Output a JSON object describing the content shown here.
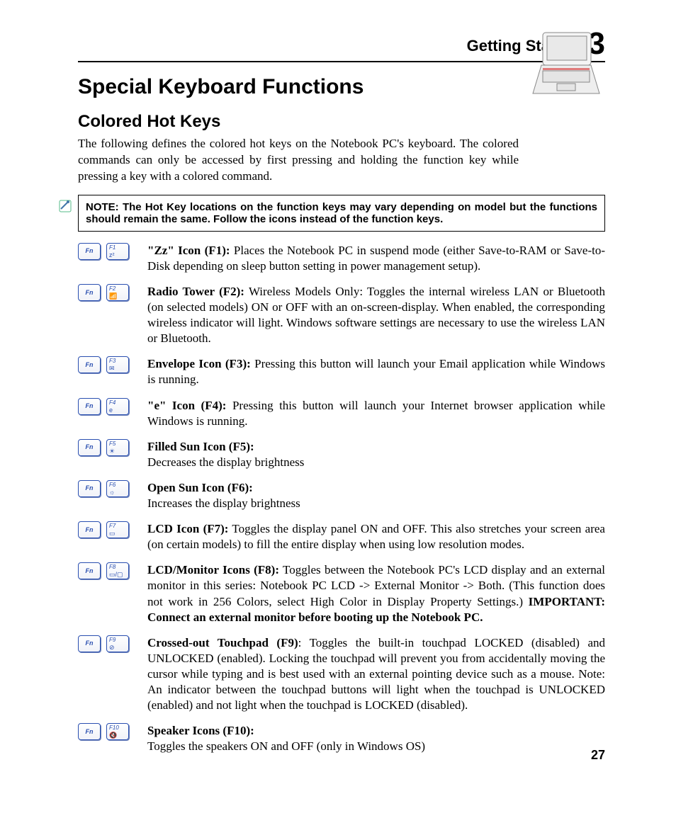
{
  "header": {
    "section_title": "Getting Started",
    "chapter_number": "3"
  },
  "titles": {
    "main": "Special Keyboard Functions",
    "sub": "Colored Hot Keys"
  },
  "intro": "The following defines the colored hot keys on the Notebook PC's keyboard. The colored commands can only be accessed by first pressing and holding the function key while pressing a key with a colored command.",
  "note": "NOTE: The Hot Key locations on the function keys may vary depending on model but the functions should remain the same. Follow the icons instead of the function keys.",
  "fn_label": "Fn",
  "hotkeys": [
    {
      "flabel": "F1",
      "glyph": "z²",
      "title": "\"Zz\" Icon (F1):",
      "desc": " Places the Notebook PC in suspend mode (either Save-to-RAM or Save-to-Disk depending on sleep button setting in power management setup)."
    },
    {
      "flabel": "F2",
      "glyph": "📶",
      "title": "Radio Tower (F2):",
      "desc": " Wireless Models Only: Toggles the internal wireless LAN or Bluetooth (on selected models) ON or OFF with an on-screen-display. When enabled, the corresponding wireless indicator will light. Windows software settings are necessary to use the wireless LAN or Bluetooth."
    },
    {
      "flabel": "F3",
      "glyph": "✉",
      "title": "Envelope Icon (F3):",
      "desc": " Pressing this button will launch your Email application while Windows is running."
    },
    {
      "flabel": "F4",
      "glyph": "e",
      "title": "\"e\" Icon (F4):",
      "desc": " Pressing this button will launch your Internet browser application while Windows is running."
    },
    {
      "flabel": "F5",
      "glyph": "☀",
      "title": "Filled Sun Icon (F5):",
      "desc": "Decreases the display brightness",
      "break": true
    },
    {
      "flabel": "F6",
      "glyph": "☼",
      "title": "Open Sun Icon (F6):",
      "desc": "Increases the display brightness",
      "break": true
    },
    {
      "flabel": "F7",
      "glyph": "▭",
      "title": "LCD Icon (F7):",
      "desc": " Toggles the display panel ON and OFF. This also stretches your screen area (on certain models) to fill the entire display when using low resolution modes."
    },
    {
      "flabel": "F8",
      "glyph": "▭/▢",
      "title": "LCD/Monitor Icons (F8):",
      "desc": " Toggles between the Notebook PC's LCD display and an external monitor in this series: Notebook PC LCD -> External Monitor -> Both. (This function does not work in 256 Colors, select High Color in Display Property Settings.) ",
      "trailing_bold": "IMPORTANT: Connect an external monitor before booting up the Notebook PC."
    },
    {
      "flabel": "F9",
      "glyph": "⊘",
      "title": "Crossed-out Touchpad (F9)",
      "desc": ": Toggles the built-in touchpad LOCKED (disabled) and UNLOCKED (enabled). Locking the touchpad will prevent you from accidentally moving the cursor while typing and is best used with an external pointing device such as a mouse. Note: An indicator between the touchpad buttons will light when the touchpad is UNLOCKED (enabled) and not light when the touchpad is LOCKED (disabled)."
    },
    {
      "flabel": "F10",
      "glyph": "🔇",
      "title": "Speaker Icons (F10):",
      "desc": "Toggles the speakers ON and OFF (only in Windows OS)",
      "break": true
    }
  ],
  "page_number": "27"
}
